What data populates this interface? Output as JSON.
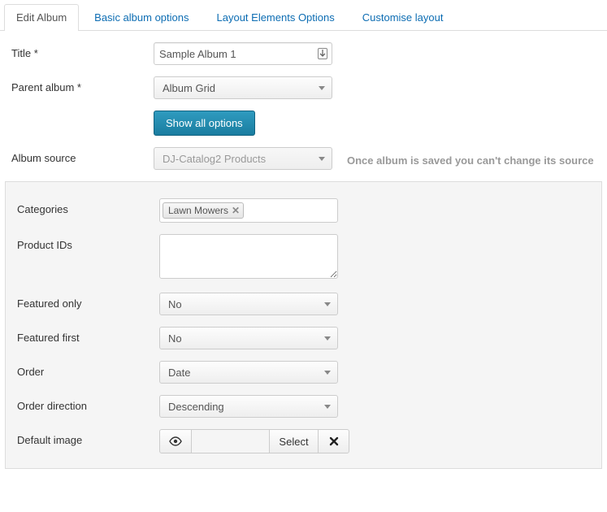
{
  "tabs": [
    {
      "label": "Edit Album",
      "active": true
    },
    {
      "label": "Basic album options",
      "active": false
    },
    {
      "label": "Layout Elements Options",
      "active": false
    },
    {
      "label": "Customise layout",
      "active": false
    }
  ],
  "form": {
    "title_label": "Title *",
    "title_value": "Sample Album 1",
    "parent_label": "Parent album *",
    "parent_value": "Album Grid",
    "show_all_button": "Show all options",
    "source_label": "Album source",
    "source_value": "DJ-Catalog2 Products",
    "source_hint": "Once album is saved you can't change its source"
  },
  "panel": {
    "categories_label": "Categories",
    "categories_tags": [
      "Lawn Mowers"
    ],
    "productids_label": "Product IDs",
    "productids_value": "",
    "featured_only_label": "Featured only",
    "featured_only_value": "No",
    "featured_first_label": "Featured first",
    "featured_first_value": "No",
    "order_label": "Order",
    "order_value": "Date",
    "order_dir_label": "Order direction",
    "order_dir_value": "Descending",
    "default_image_label": "Default image",
    "default_image_select": "Select"
  }
}
